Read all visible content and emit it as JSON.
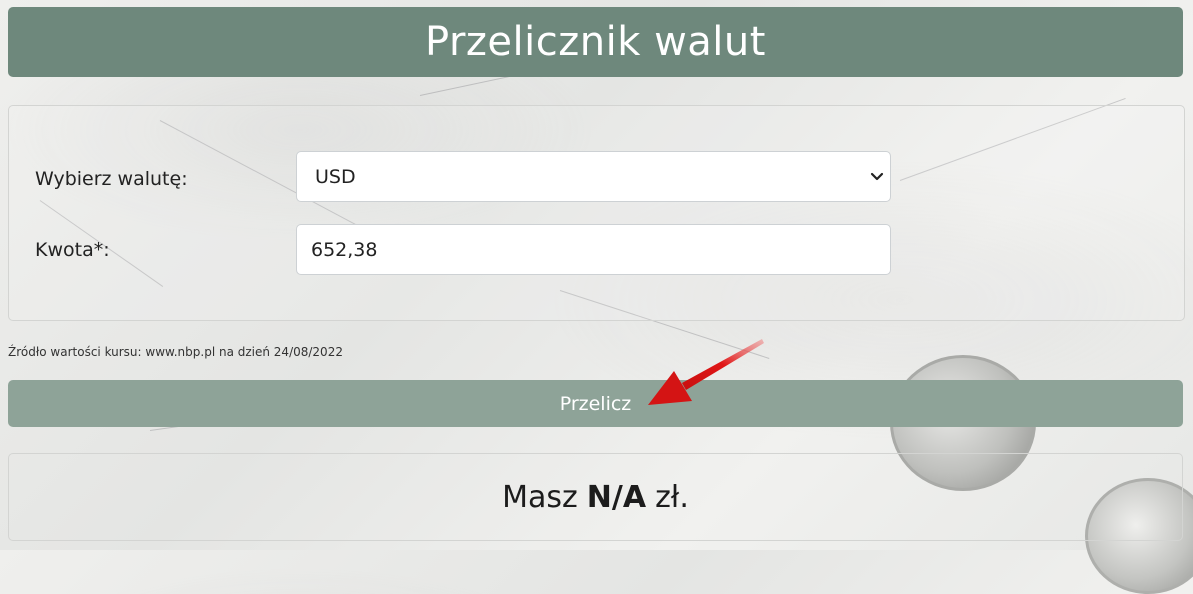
{
  "header": {
    "title": "Przelicznik walut"
  },
  "form": {
    "currency_label": "Wybierz walutę:",
    "currency_value": "USD",
    "amount_label": "Kwota*:",
    "amount_value": "652,38"
  },
  "source_note": "Źródło wartości kursu: www.nbp.pl na dzień 24/08/2022",
  "button": {
    "label": "Przelicz"
  },
  "result": {
    "prefix": "Masz",
    "value": "N/A",
    "suffix": "zł."
  },
  "colors": {
    "header_bg": "#6e887c",
    "button_bg": "#8ea398",
    "arrow": "#e01616"
  },
  "icons": {
    "select_chevron": "chevron-down-icon",
    "pointer_arrow": "red-arrow-icon"
  }
}
